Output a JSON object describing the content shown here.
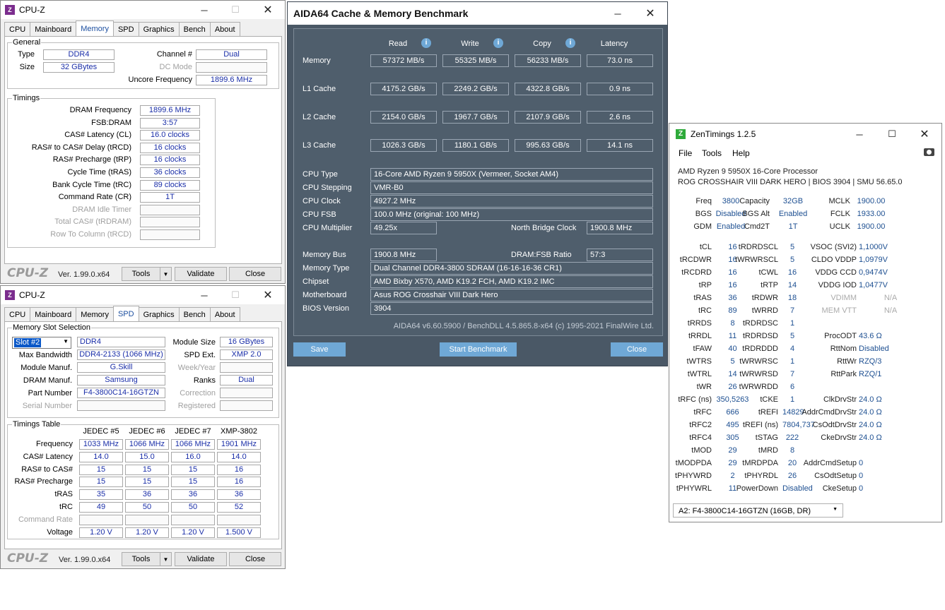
{
  "cpuz1": {
    "title": "CPU-Z",
    "tabs": [
      "CPU",
      "Mainboard",
      "Memory",
      "SPD",
      "Graphics",
      "Bench",
      "About"
    ],
    "general_label": "General",
    "type_label": "Type",
    "type_value": "DDR4",
    "size_label": "Size",
    "size_value": "32 GBytes",
    "channel_label": "Channel #",
    "channel_value": "Dual",
    "dcmode_label": "DC Mode",
    "uncore_label": "Uncore Frequency",
    "uncore_value": "1899.6 MHz",
    "timings_label": "Timings",
    "timings": [
      {
        "label": "DRAM Frequency",
        "value": "1899.6 MHz"
      },
      {
        "label": "FSB:DRAM",
        "value": "3:57"
      },
      {
        "label": "CAS# Latency (CL)",
        "value": "16.0 clocks"
      },
      {
        "label": "RAS# to CAS# Delay (tRCD)",
        "value": "16 clocks"
      },
      {
        "label": "RAS# Precharge (tRP)",
        "value": "16 clocks"
      },
      {
        "label": "Cycle Time (tRAS)",
        "value": "36 clocks"
      },
      {
        "label": "Bank Cycle Time (tRC)",
        "value": "89 clocks"
      },
      {
        "label": "Command Rate (CR)",
        "value": "1T"
      },
      {
        "label": "DRAM Idle Timer",
        "value": ""
      },
      {
        "label": "Total CAS# (tRDRAM)",
        "value": ""
      },
      {
        "label": "Row To Column (tRCD)",
        "value": ""
      }
    ],
    "logo": "CPU-Z",
    "version": "Ver. 1.99.0.x64",
    "tools": "Tools",
    "validate": "Validate",
    "close": "Close"
  },
  "cpuz2": {
    "title": "CPU-Z",
    "tabs": [
      "CPU",
      "Mainboard",
      "Memory",
      "SPD",
      "Graphics",
      "Bench",
      "About"
    ],
    "slot_group": "Memory Slot Selection",
    "slot_value": "Slot #2",
    "slot_type": "DDR4",
    "module_size_label": "Module Size",
    "module_size": "16 GBytes",
    "max_bw_label": "Max Bandwidth",
    "max_bw": "DDR4-2133 (1066 MHz)",
    "spd_ext_label": "SPD Ext.",
    "spd_ext": "XMP 2.0",
    "module_manuf_label": "Module Manuf.",
    "module_manuf": "G.Skill",
    "week_label": "Week/Year",
    "dram_manuf_label": "DRAM Manuf.",
    "dram_manuf": "Samsung",
    "ranks_label": "Ranks",
    "ranks": "Dual",
    "part_label": "Part Number",
    "part": "F4-3800C14-16GTZN",
    "correction_label": "Correction",
    "serial_label": "Serial Number",
    "registered_label": "Registered",
    "table_group": "Timings Table",
    "cols": [
      "JEDEC #5",
      "JEDEC #6",
      "JEDEC #7",
      "XMP-3802"
    ],
    "rows": [
      {
        "label": "Frequency",
        "v": [
          "1033 MHz",
          "1066 MHz",
          "1066 MHz",
          "1901 MHz"
        ]
      },
      {
        "label": "CAS# Latency",
        "v": [
          "14.0",
          "15.0",
          "16.0",
          "14.0"
        ]
      },
      {
        "label": "RAS# to CAS#",
        "v": [
          "15",
          "15",
          "15",
          "16"
        ]
      },
      {
        "label": "RAS# Precharge",
        "v": [
          "15",
          "15",
          "15",
          "16"
        ]
      },
      {
        "label": "tRAS",
        "v": [
          "35",
          "36",
          "36",
          "36"
        ]
      },
      {
        "label": "tRC",
        "v": [
          "49",
          "50",
          "50",
          "52"
        ]
      },
      {
        "label": "Command Rate",
        "v": [
          "",
          "",
          "",
          ""
        ]
      },
      {
        "label": "Voltage",
        "v": [
          "1.20 V",
          "1.20 V",
          "1.20 V",
          "1.500 V"
        ]
      }
    ],
    "logo": "CPU-Z",
    "version": "Ver. 1.99.0.x64",
    "tools": "Tools",
    "validate": "Validate",
    "close": "Close"
  },
  "aida": {
    "title": "AIDA64 Cache & Memory Benchmark",
    "headers": [
      "Read",
      "Write",
      "Copy",
      "Latency"
    ],
    "bench_rows": [
      {
        "label": "Memory",
        "v": [
          "57372 MB/s",
          "55325 MB/s",
          "56233 MB/s",
          "73.0 ns"
        ]
      },
      {
        "label": "L1 Cache",
        "v": [
          "4175.2 GB/s",
          "2249.2 GB/s",
          "4322.8 GB/s",
          "0.9 ns"
        ]
      },
      {
        "label": "L2 Cache",
        "v": [
          "2154.0 GB/s",
          "1967.7 GB/s",
          "2107.9 GB/s",
          "2.6 ns"
        ]
      },
      {
        "label": "L3 Cache",
        "v": [
          "1026.3 GB/s",
          "1180.1 GB/s",
          "995.63 GB/s",
          "14.1 ns"
        ]
      }
    ],
    "cpu_type_label": "CPU Type",
    "cpu_type": "16-Core AMD Ryzen 9 5950X  (Vermeer, Socket AM4)",
    "cpu_stepping_label": "CPU Stepping",
    "cpu_stepping": "VMR-B0",
    "cpu_clock_label": "CPU Clock",
    "cpu_clock": "4927.2 MHz",
    "cpu_fsb_label": "CPU FSB",
    "cpu_fsb": "100.0 MHz  (original: 100 MHz)",
    "cpu_mult_label": "CPU Multiplier",
    "cpu_mult": "49.25x",
    "nb_clock_label": "North Bridge Clock",
    "nb_clock": "1900.8 MHz",
    "mem_bus_label": "Memory Bus",
    "mem_bus": "1900.8 MHz",
    "dram_fsb_label": "DRAM:FSB Ratio",
    "dram_fsb": "57:3",
    "mem_type_label": "Memory Type",
    "mem_type": "Dual Channel DDR4-3800 SDRAM  (16-16-16-36 CR1)",
    "chipset_label": "Chipset",
    "chipset": "AMD Bixby X570, AMD K19.2 FCH, AMD K19.2 IMC",
    "mobo_label": "Motherboard",
    "mobo": "Asus ROG Crosshair VIII Dark Hero",
    "bios_label": "BIOS Version",
    "bios": "3904",
    "footer": "AIDA64 v6.60.5900 / BenchDLL 4.5.865.8-x64  (c) 1995-2021 FinalWire Ltd.",
    "save": "Save",
    "start": "Start Benchmark",
    "close": "Close"
  },
  "zen": {
    "title": "ZenTimings 1.2.5",
    "menu": [
      "File",
      "Tools",
      "Help"
    ],
    "cpu": "AMD Ryzen 9 5950X 16-Core Processor",
    "board": "ROG CROSSHAIR VIII DARK HERO | BIOS 3904 | SMU 56.65.0",
    "top": [
      [
        "Freq",
        "3800",
        "Capacity",
        "32GB",
        "MCLK",
        "1900.00"
      ],
      [
        "BGS",
        "Disabled",
        "BGS Alt",
        "Enabled",
        "FCLK",
        "1933.00"
      ],
      [
        "GDM",
        "Enabled",
        "Cmd2T",
        "1T",
        "UCLK",
        "1900.00"
      ]
    ],
    "rows": [
      [
        "tCL",
        "16",
        "tRDRDSCL",
        "5",
        "VSOC (SVI2)",
        "1,1000V"
      ],
      [
        "tRCDWR",
        "16",
        "tWRWRSCL",
        "5",
        "CLDO VDDP",
        "1,0979V"
      ],
      [
        "tRCDRD",
        "16",
        "tCWL",
        "16",
        "VDDG CCD",
        "0,9474V"
      ],
      [
        "tRP",
        "16",
        "tRTP",
        "14",
        "VDDG IOD",
        "1,0477V"
      ],
      [
        "tRAS",
        "36",
        "tRDWR",
        "18",
        "VDIMM",
        "N/A"
      ],
      [
        "tRC",
        "89",
        "tWRRD",
        "7",
        "MEM VTT",
        "N/A"
      ],
      [
        "tRRDS",
        "8",
        "tRDRDSC",
        "1",
        "",
        ""
      ],
      [
        "tRRDL",
        "11",
        "tRDRDSD",
        "5",
        "ProcODT",
        "43.6 Ω"
      ],
      [
        "tFAW",
        "40",
        "tRDRDDD",
        "4",
        "RttNom",
        "Disabled"
      ],
      [
        "tWTRS",
        "5",
        "tWRWRSC",
        "1",
        "RttWr",
        "RZQ/3"
      ],
      [
        "tWTRL",
        "14",
        "tWRWRSD",
        "7",
        "RttPark",
        "RZQ/1"
      ],
      [
        "tWR",
        "26",
        "tWRWRDD",
        "6",
        "",
        ""
      ],
      [
        "tRFC (ns)",
        "350,5263",
        "tCKE",
        "1",
        "ClkDrvStr",
        "24.0 Ω"
      ],
      [
        "tRFC",
        "666",
        "tREFI",
        "14829",
        "AddrCmdDrvStr",
        "24.0 Ω"
      ],
      [
        "tRFC2",
        "495",
        "tREFI (ns)",
        "7804,737",
        "CsOdtDrvStr",
        "24.0 Ω"
      ],
      [
        "tRFC4",
        "305",
        "tSTAG",
        "222",
        "CkeDrvStr",
        "24.0 Ω"
      ],
      [
        "tMOD",
        "29",
        "tMRD",
        "8",
        "",
        ""
      ],
      [
        "tMODPDA",
        "29",
        "tMRDPDA",
        "20",
        "AddrCmdSetup",
        "0"
      ],
      [
        "tPHYWRD",
        "2",
        "tPHYRDL",
        "26",
        "CsOdtSetup",
        "0"
      ],
      [
        "tPHYWRL",
        "11",
        "PowerDown",
        "Disabled",
        "CkeSetup",
        "0"
      ]
    ],
    "dimm_select": "A2: F4-3800C14-16GTZN (16GB, DR)"
  }
}
